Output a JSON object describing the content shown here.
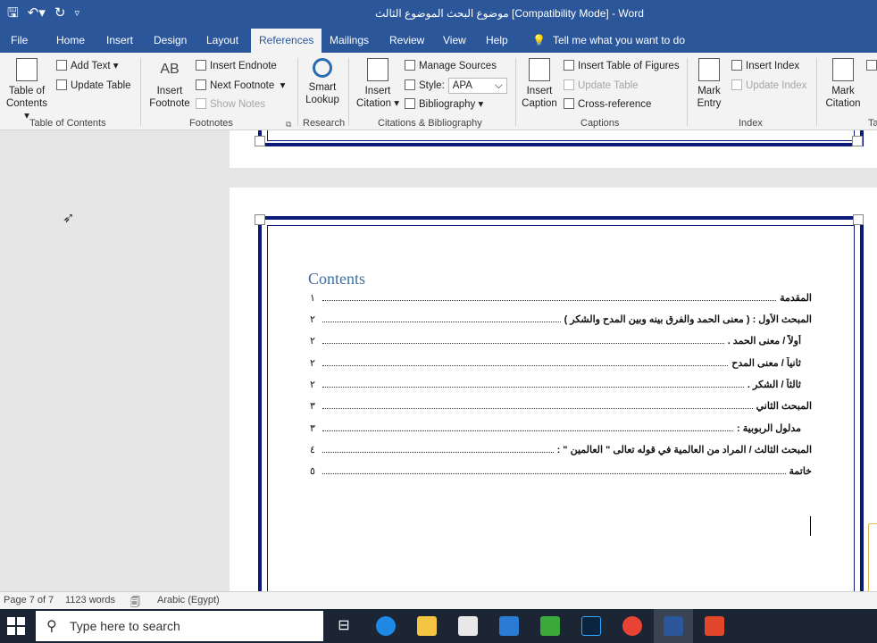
{
  "titlebar": {
    "title": "موضوع البحث الموضوع الثالث [Compatibility Mode]  -  Word",
    "icons": [
      "save-icon",
      "undo-icon",
      "redo-icon",
      "customize-qat-icon"
    ]
  },
  "tabs": [
    {
      "label": "File"
    },
    {
      "label": "Home"
    },
    {
      "label": "Insert"
    },
    {
      "label": "Design"
    },
    {
      "label": "Layout"
    },
    {
      "label": "References"
    },
    {
      "label": "Mailings"
    },
    {
      "label": "Review"
    },
    {
      "label": "View"
    },
    {
      "label": "Help"
    }
  ],
  "tellme": "Tell me what you want to do",
  "ribbon": {
    "toc": {
      "table_of_contents": [
        "Table of",
        "Contents"
      ],
      "add_text": "Add Text",
      "update_table": "Update Table",
      "group": "Table of Contents"
    },
    "footnotes": {
      "insert_footnote": [
        "Insert",
        "Footnote"
      ],
      "insert_endnote": "Insert Endnote",
      "next_footnote": "Next Footnote",
      "show_notes": "Show Notes",
      "group": "Footnotes",
      "ab_icon": "AB"
    },
    "research": {
      "smart_lookup": [
        "Smart",
        "Lookup"
      ],
      "group": "Research"
    },
    "citations": {
      "insert_citation": [
        "Insert",
        "Citation"
      ],
      "manage_sources": "Manage Sources",
      "style_label": "Style:",
      "style_value": "APA",
      "bibliography": "Bibliography",
      "group": "Citations & Bibliography"
    },
    "captions": {
      "insert_caption": [
        "Insert",
        "Caption"
      ],
      "insert_table_of_figures": "Insert Table of Figures",
      "update_table": "Update Table",
      "cross_reference": "Cross-reference",
      "group": "Captions"
    },
    "index": {
      "mark_entry": [
        "Mark",
        "Entry"
      ],
      "insert_index": "Insert Index",
      "update_index": "Update Index",
      "group": "Index"
    },
    "toa": {
      "mark_citation": [
        "Mark",
        "Citation"
      ],
      "group": "Ta"
    }
  },
  "document": {
    "toc_title": "Contents",
    "toc_entries": [
      {
        "text": "المقدمة",
        "page": "١"
      },
      {
        "text": "المبحث الأول : ( معنى الحمد والفرق بينه وبين المدح والشكر )",
        "page": "٢"
      },
      {
        "text": "أولاً / معنى الحمد .",
        "page": "٢"
      },
      {
        "text": "ثانياً / معنى المدح",
        "page": "٢"
      },
      {
        "text": "ثالثاً / الشكر .",
        "page": "٢"
      },
      {
        "text": "المبحث الثاني",
        "page": "٣"
      },
      {
        "text": "مدلول الربوبية :",
        "page": "٣"
      },
      {
        "text": "المبحث الثالث / المراد من العالمية في قوله تعالى \" العالمين \" :",
        "page": "٤"
      },
      {
        "text": "خاتمة",
        "page": "٥"
      }
    ]
  },
  "statusbar": {
    "page": "Page 7 of 7",
    "words": "1123 words",
    "language": "Arabic (Egypt)"
  },
  "taskbar": {
    "search_placeholder": "Type here to search",
    "apps": [
      "task-view-icon",
      "edge-icon",
      "file-explorer-icon",
      "store-icon",
      "mail-icon",
      "camtasia-icon",
      "photoshop-icon",
      "chrome-icon",
      "word-icon",
      "camtasia-recorder-icon"
    ]
  },
  "colors": {
    "word_blue": "#2b579a",
    "page_border": "#0b1a78",
    "toc_heading": "#3f6ea0"
  }
}
